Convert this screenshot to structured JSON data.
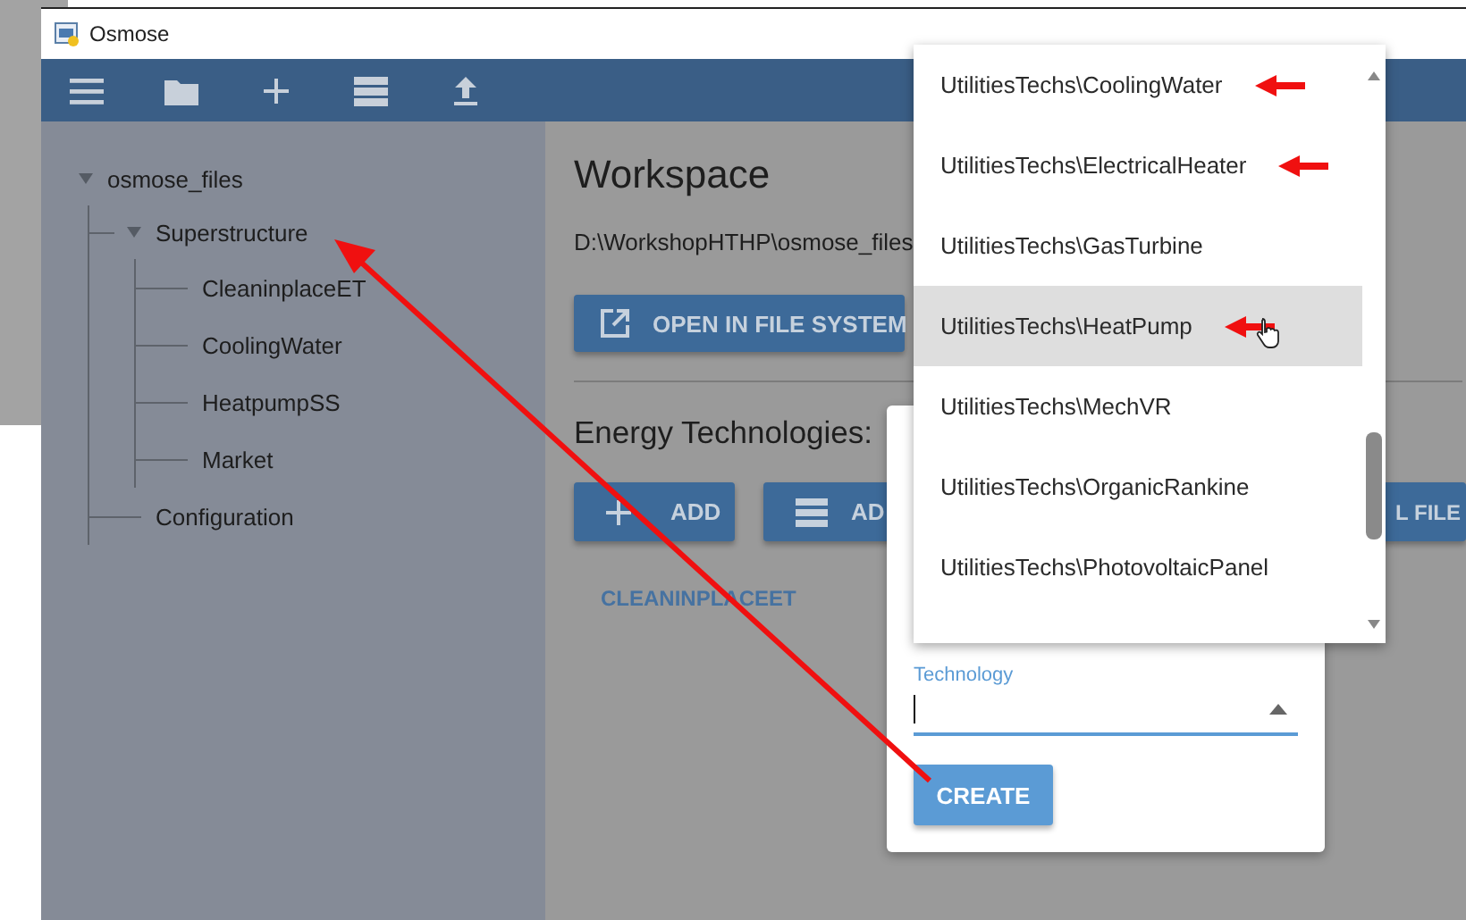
{
  "window": {
    "title": "Osmose"
  },
  "tree": [
    {
      "label": "osmose_files",
      "expanded": true,
      "children": [
        {
          "label": "Superstructure",
          "expanded": true,
          "children": [
            {
              "label": "CleaninplaceET"
            },
            {
              "label": "CoolingWater"
            },
            {
              "label": "HeatpumpSS"
            },
            {
              "label": "Market"
            }
          ]
        },
        {
          "label": "Configuration"
        }
      ]
    }
  ],
  "workspace": {
    "title": "Workspace",
    "path": "D:\\WorkshopHTHP\\osmose_files",
    "open_button": "OPEN IN FILE SYSTEM"
  },
  "energy_technologies": {
    "title": "Energy Technologies:",
    "buttons": [
      {
        "kind": "add",
        "label": "ADD"
      },
      {
        "kind": "list",
        "label": "AD"
      },
      {
        "kind": "plain",
        "label": "L FILE"
      }
    ],
    "items": [
      "CLEANINPLACEET"
    ]
  },
  "dialog": {
    "field": {
      "label": "Technology",
      "focused": true
    },
    "button": "CREATE"
  },
  "dropdown": {
    "options": [
      {
        "label": "UtilitiesTechs\\CoolingWater",
        "selected": false,
        "marked": true
      },
      {
        "label": "UtilitiesTechs\\ElectricalHeater",
        "selected": false,
        "marked": true
      },
      {
        "label": "UtilitiesTechs\\GasTurbine",
        "selected": false,
        "marked": false
      },
      {
        "label": "UtilitiesTechs\\HeatPump",
        "selected": true,
        "marked": true
      },
      {
        "label": "UtilitiesTechs\\MechVR",
        "selected": false,
        "marked": false
      },
      {
        "label": "UtilitiesTechs\\OrganicRankine",
        "selected": false,
        "marked": false
      },
      {
        "label": "UtilitiesTechs\\PhotovoltaicPanel",
        "selected": false,
        "marked": false
      }
    ]
  }
}
